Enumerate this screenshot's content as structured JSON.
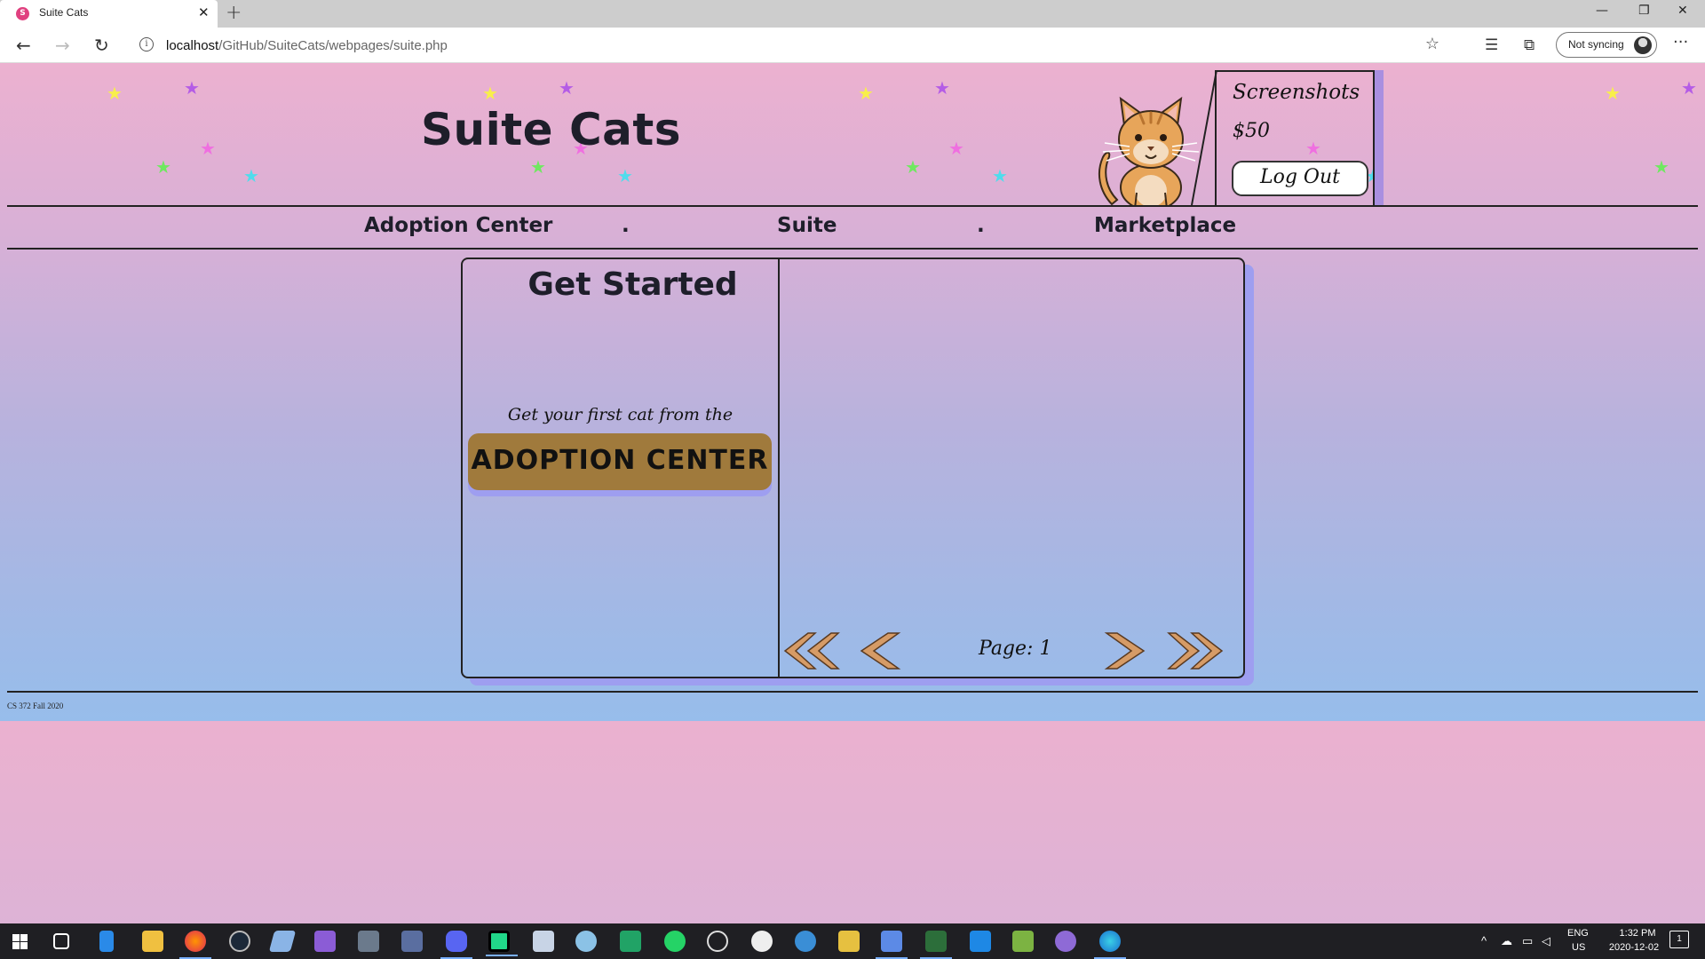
{
  "browser": {
    "tab_title": "Suite Cats",
    "tab_favicon": "S",
    "url_host": "localhost",
    "url_path": "/GitHub/SuiteCats/webpages/suite.php",
    "sync_label": "Not syncing"
  },
  "site": {
    "title": "Suite Cats"
  },
  "account": {
    "username": "Screenshots",
    "money": "$50",
    "logout_label": "Log Out"
  },
  "nav": {
    "adoption_center": "Adoption Center",
    "suite": "Suite",
    "marketplace": "Marketplace",
    "separator": "."
  },
  "suite": {
    "heading": "Get Started",
    "intro": "Get your first cat from the",
    "adopt_button": "ADOPTION CENTER",
    "page_label": "Page: 1"
  },
  "footer": {
    "text": "CS 372 Fall 2020"
  },
  "taskbar": {
    "language_top": "ENG",
    "language_bottom": "US",
    "time": "1:32 PM",
    "date": "2020-12-02",
    "notification_count": "1"
  },
  "colors": {
    "brand_text": "#1e1e2a",
    "adopt_button": "#a07a3c",
    "accent_shadow": "#9e9ef0",
    "arrow_fill": "#d69b66"
  }
}
